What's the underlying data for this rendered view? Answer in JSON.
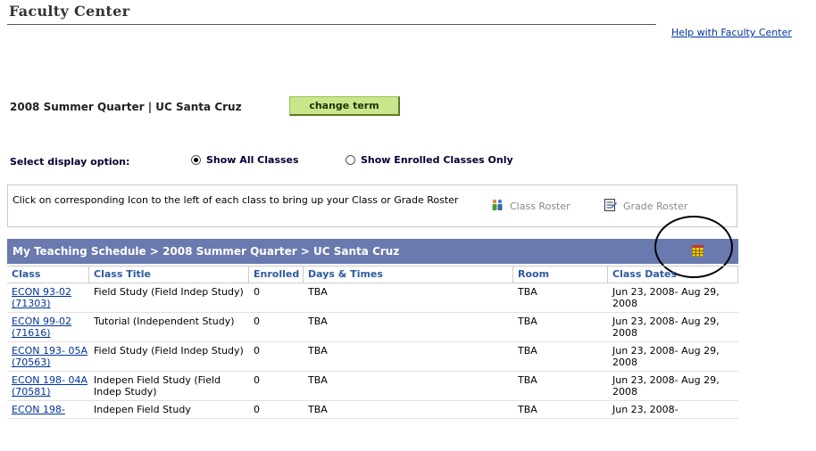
{
  "page": {
    "title": "Faculty Center",
    "help_link": "Help with Faculty Center"
  },
  "term": {
    "label": "2008 Summer Quarter | UC Santa Cruz",
    "change_button": "change term"
  },
  "display_option": {
    "label": "Select display option:",
    "options": [
      {
        "label": "Show All Classes",
        "selected": true
      },
      {
        "label": "Show Enrolled Classes Only",
        "selected": false
      }
    ]
  },
  "info": {
    "text": "Click on corresponding Icon to the left of each class to bring up your Class or Grade Roster",
    "class_roster": "Class Roster",
    "grade_roster": "Grade Roster"
  },
  "schedule": {
    "title": "My Teaching Schedule > 2008 Summer Quarter > UC Santa Cruz",
    "columns": [
      "Class",
      "Class Title",
      "Enrolled",
      "Days & Times",
      "Room",
      "Class Dates"
    ],
    "rows": [
      {
        "cls": "ECON 93-02 (71303)",
        "title": "Field Study (Field Indep Study)",
        "enrolled": "0",
        "days": "TBA",
        "room": "TBA",
        "dates": "Jun 23, 2008- Aug 29, 2008"
      },
      {
        "cls": "ECON 99-02 (71616)",
        "title": "Tutorial (Independent Study)",
        "enrolled": "0",
        "days": "TBA",
        "room": "TBA",
        "dates": "Jun 23, 2008- Aug 29, 2008"
      },
      {
        "cls": "ECON 193- 05A (70563)",
        "title": "Field Study (Field Indep Study)",
        "enrolled": "0",
        "days": "TBA",
        "room": "TBA",
        "dates": "Jun 23, 2008- Aug 29, 2008"
      },
      {
        "cls": "ECON 198- 04A (70581)",
        "title": "Indepen Field Study (Field Indep Study)",
        "enrolled": "0",
        "days": "TBA",
        "room": "TBA",
        "dates": "Jun 23, 2008- Aug 29, 2008"
      },
      {
        "cls": "ECON 198-",
        "title": "Indepen Field Study",
        "enrolled": "0",
        "days": "TBA",
        "room": "TBA",
        "dates": "Jun 23, 2008-"
      }
    ]
  },
  "colors": {
    "header_bg": "#6a79ae",
    "link": "#003399",
    "button_bg": "#c9e68d"
  }
}
